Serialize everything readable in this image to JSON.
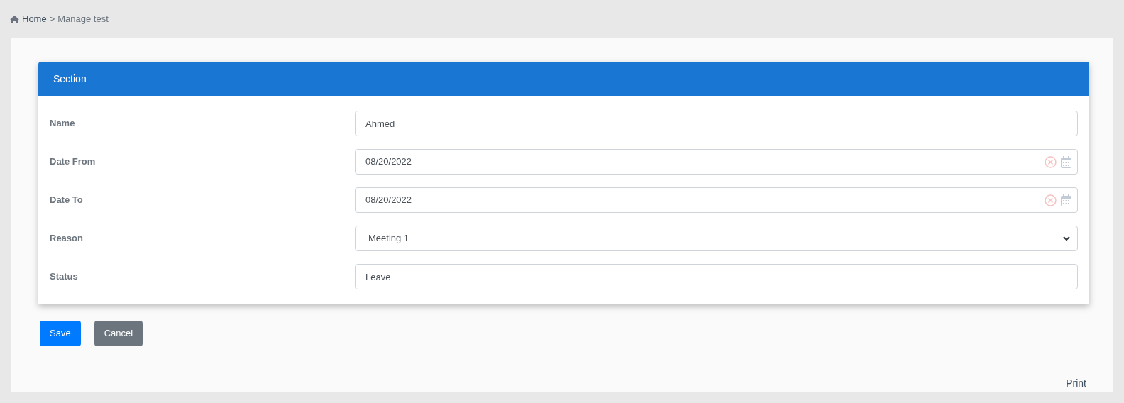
{
  "breadcrumb": {
    "home": "Home",
    "separator": ">",
    "current": "Manage test"
  },
  "section": {
    "title": "Section"
  },
  "fields": [
    {
      "kind": "text",
      "label": "Name",
      "value": "Ahmed"
    },
    {
      "kind": "date",
      "label": "Date From",
      "value": "08/20/2022"
    },
    {
      "kind": "date",
      "label": "Date To",
      "value": "08/20/2022"
    },
    {
      "kind": "select",
      "label": "Reason",
      "value": "Meeting 1"
    },
    {
      "kind": "text",
      "label": "Status",
      "value": "Leave"
    }
  ],
  "buttons": [
    {
      "kind": "primary",
      "label": "Save"
    },
    {
      "kind": "secondary",
      "label": "Cancel"
    }
  ],
  "print": "Print"
}
